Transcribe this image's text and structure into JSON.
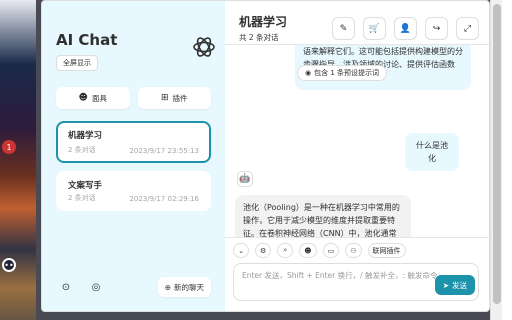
{
  "sidebar": {
    "title": "AI Chat",
    "fullscreen_label": "全屏显示",
    "mask_label": "面具",
    "plugin_label": "插件",
    "new_chat_label": "新的聊天",
    "chats": [
      {
        "title": "机器学习",
        "count": "2 条对话",
        "date": "2023/9/17 23:55:13",
        "active": true
      },
      {
        "title": "文案写手",
        "count": "2 条对话",
        "date": "2023/9/17 02:29:16",
        "active": false
      }
    ]
  },
  "chat": {
    "title": "机器学习",
    "subtitle": "共 2 条对话",
    "mask_pill": "包含 1 条预设提示词",
    "messages": [
      {
        "role": "bot",
        "text": "语来解释它们。这可能包括提供构建模型的分步骤指导、涉及领域的讨论、提供评估函数等。我的问题是"
      },
      {
        "role": "user",
        "text": "什么是池化"
      },
      {
        "role": "bot",
        "text": "池化（Pooling）是一种在机器学习中常用的操作，它用于减少模型的维度并提取重要特征。在卷积神经网络（CNN）中，池化通常紧跟在"
      }
    ],
    "input_placeholder": "Enter 发送，Shift + Enter 换行，/ 触发补全，: 触发命令",
    "send_label": "发送",
    "web_plugin_label": "联网插件"
  },
  "colors": {
    "accent": "#1d93ab",
    "sidebar_bg": "#e7f8ff"
  }
}
